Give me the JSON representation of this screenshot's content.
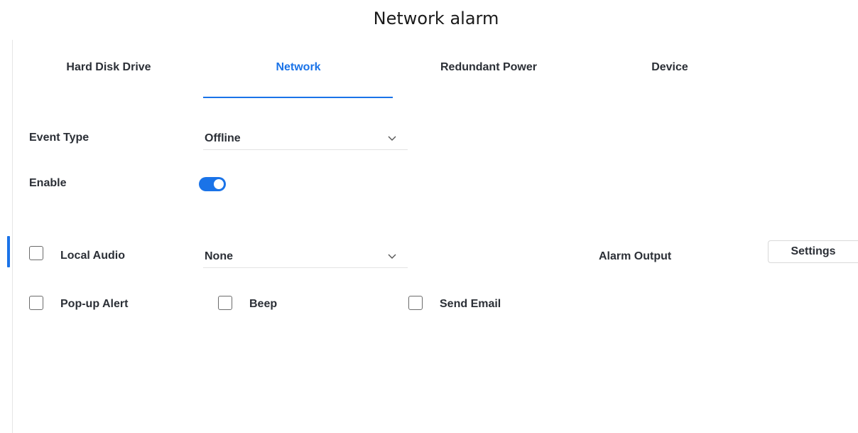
{
  "header": {
    "title": "Network alarm"
  },
  "tabs": [
    {
      "label": "Hard Disk Drive",
      "active": false
    },
    {
      "label": "Network",
      "active": true
    },
    {
      "label": "Redundant Power",
      "active": false
    },
    {
      "label": "Device",
      "active": false
    }
  ],
  "form": {
    "event_type": {
      "label": "Event Type",
      "value": "Offline"
    },
    "enable": {
      "label": "Enable",
      "checked": true
    },
    "local_audio": {
      "label": "Local Audio",
      "checked": false,
      "value": "None"
    },
    "alarm_output": {
      "label": "Alarm Output",
      "button_label": "Settings"
    },
    "popup_alert": {
      "label": "Pop-up Alert",
      "checked": false
    },
    "beep": {
      "label": "Beep",
      "checked": false
    },
    "send_email": {
      "label": "Send Email",
      "checked": false
    }
  },
  "colors": {
    "accent": "#1a73e8",
    "text": "#2b2f36"
  },
  "icons": {
    "dropdown": "chevron-down-icon"
  }
}
